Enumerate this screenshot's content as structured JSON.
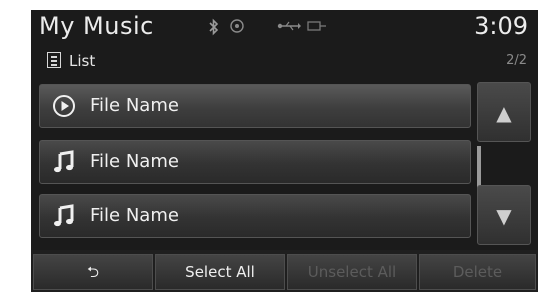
{
  "header": {
    "title": "My Music",
    "clock": "3:09"
  },
  "status_icons": [
    "bluetooth-icon",
    "radio-icon",
    "usb-icon",
    "aux-icon"
  ],
  "list_header": {
    "label": "List",
    "page": "2/2"
  },
  "rows": [
    {
      "icon": "play-icon",
      "label": "File Name"
    },
    {
      "icon": "music-note-icon",
      "label": "File Name"
    },
    {
      "icon": "music-note-icon",
      "label": "File Name"
    }
  ],
  "scroll": {
    "up_symbol": "▲",
    "down_symbol": "▼"
  },
  "bottom": {
    "back_symbol": "⮌",
    "select_all": "Select All",
    "unselect_all": "Unselect All",
    "delete": "Delete"
  }
}
